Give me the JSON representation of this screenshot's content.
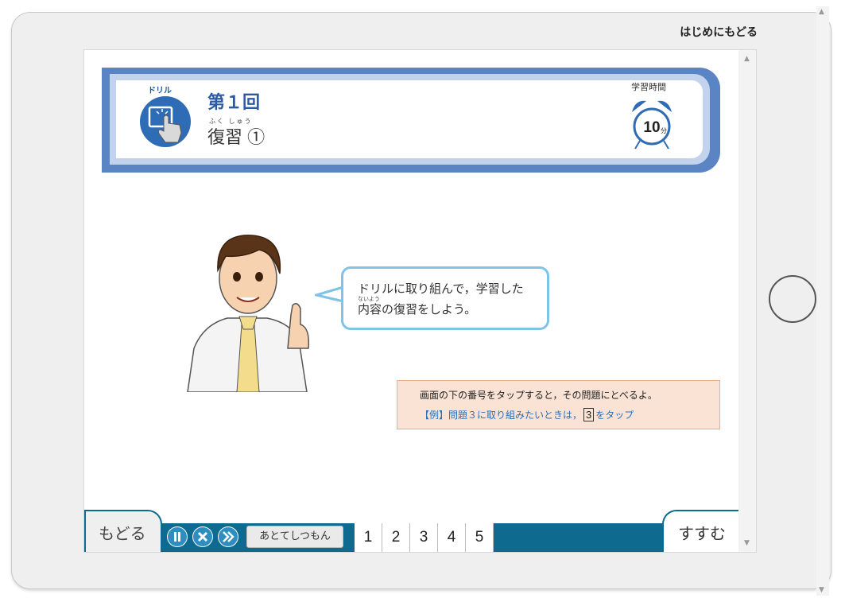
{
  "top": {
    "back_to_start": "はじめにもどる"
  },
  "header": {
    "drill_label": "ドリル",
    "lesson_number": "第１回",
    "title_ruby": "ふく しゅう",
    "title": "復習 ①",
    "timer_label": "学習時間",
    "timer_minutes": "10",
    "timer_unit": "分"
  },
  "speech": {
    "line1": "ドリルに取り組んで，学習した",
    "ruby": "ないよう",
    "line2": "内容の復習をしよう。"
  },
  "hint": {
    "line1": "画面の下の番号をタップすると，その問題にとべるよ。",
    "line2_prefix": "【例】問題３に取り組みたいときは，",
    "line2_box": "3",
    "line2_suffix": "をタップ"
  },
  "bottom": {
    "back_label": "もどる",
    "later_label": "あとてしつもん",
    "numbers": [
      "1",
      "2",
      "3",
      "4",
      "5"
    ],
    "next_label": "すすむ"
  },
  "colors": {
    "accent": "#0e6a8e",
    "header_blue": "#5b84c4",
    "hint_bg": "#fae3d5"
  },
  "icons": [
    "pause-icon",
    "close-icon",
    "fast-forward-icon",
    "alarm-clock-icon",
    "tap-hand-icon"
  ]
}
